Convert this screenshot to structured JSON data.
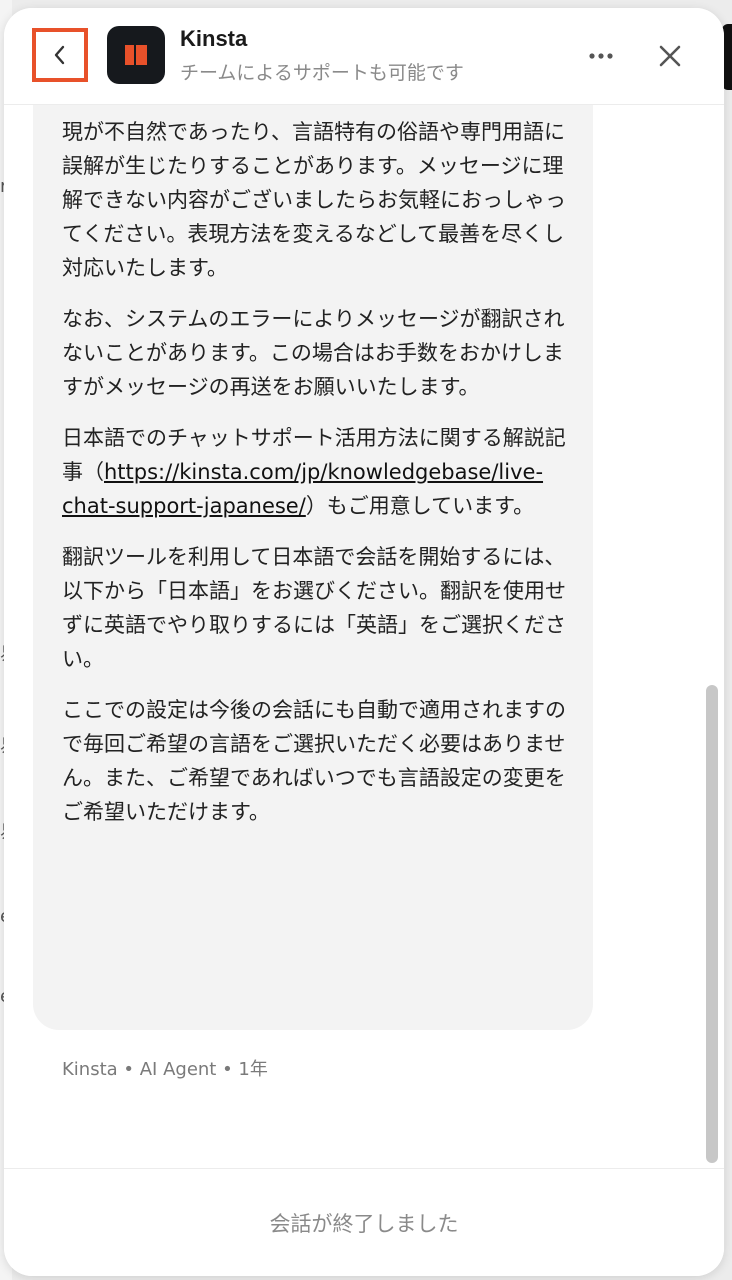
{
  "header": {
    "title": "Kinsta",
    "subtitle": "チームによるサポートも可能です",
    "back_icon": "chevron-left-icon",
    "more_icon": "more-horizontal-icon",
    "close_icon": "close-icon",
    "accent_color": "#e8512a"
  },
  "message": {
    "paragraphs": [
      "現が不自然であったり、言語特有の俗語や専門用語に誤解が生じたりすることがあります。メッセージに理解できない内容がございましたらお気軽におっしゃってください。表現方法を変えるなどして最善を尽くし対応いたします。",
      "なお、システムのエラーによりメッセージが翻訳されないことがあります。この場合はお手数をおかけしますがメッセージの再送をお願いいたします。",
      "翻訳ツールを利用して日本語で会話を開始するには、以下から「日本語」をお選びください。翻訳を使用せずに英語でやり取りするには「英語」をご選択ください。",
      "ここでの設定は今後の会話にも自動で適用されますので毎回ご希望の言語をご選択いただく必要はありません。また、ご希望であればいつでも言語設定の変更をご希望いただけます。"
    ],
    "link_paragraph": {
      "before": "日本語でのチャットサポート活用方法に関する解説記事（",
      "link_text": "https://kinsta.com/jp/knowledgebase/live-chat-support-japanese/",
      "after": "）もご用意しています。"
    },
    "meta": "Kinsta • AI Agent • 1年"
  },
  "footer": {
    "status": "会話が終了しました"
  },
  "background": {
    "chars": [
      "r",
      "易",
      "易",
      "易",
      "e",
      "e"
    ]
  }
}
